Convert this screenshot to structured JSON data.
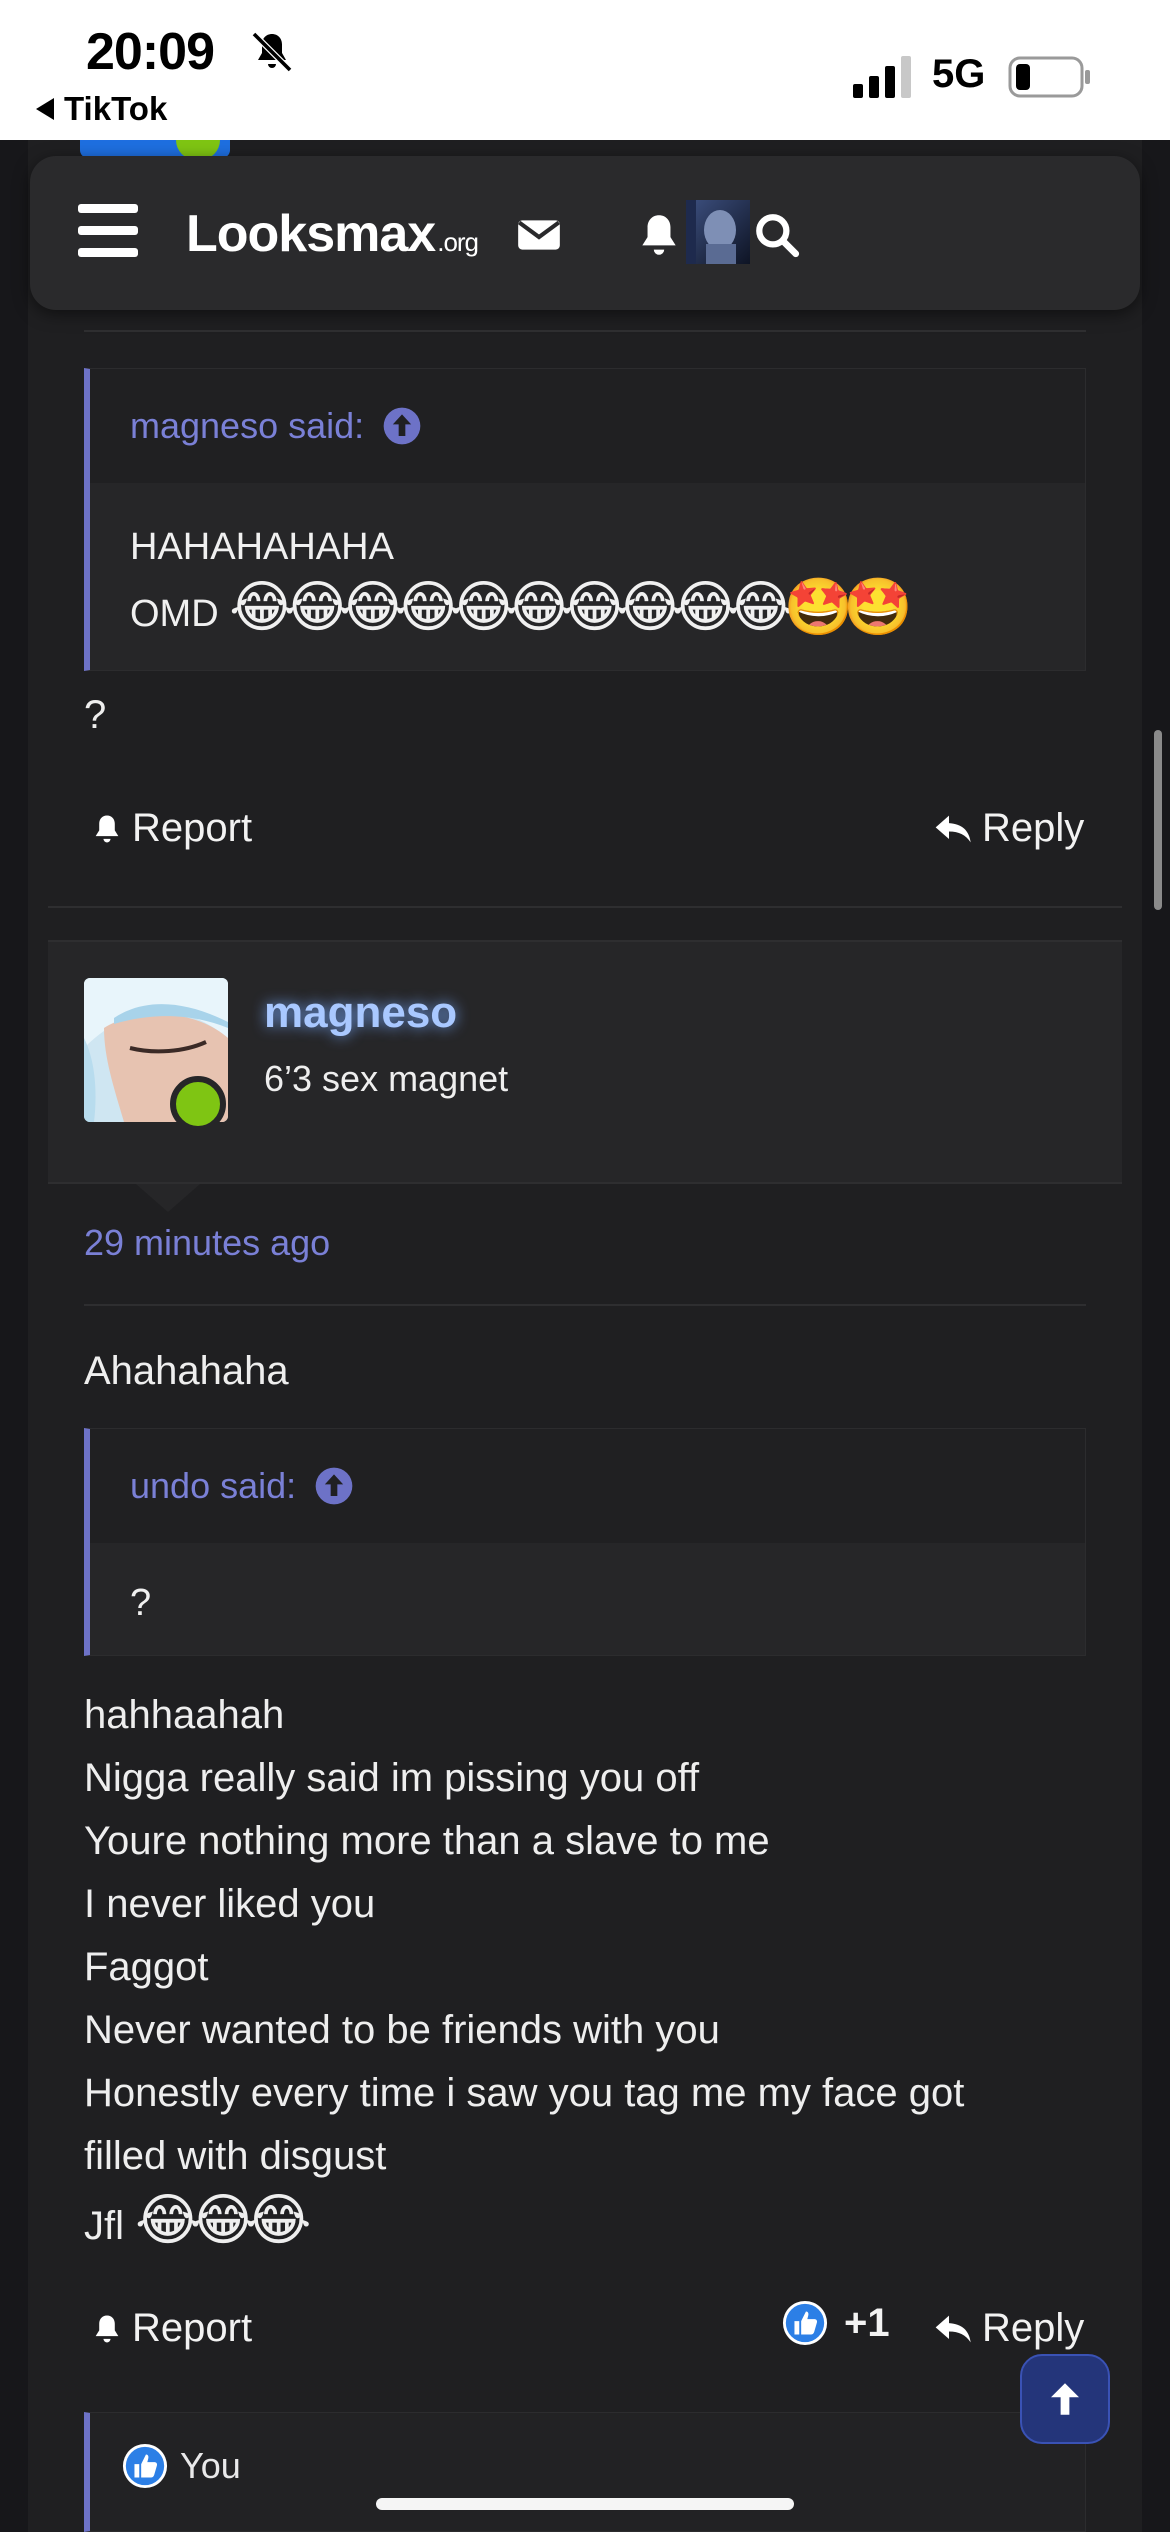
{
  "status_bar": {
    "time": "20:09",
    "back_app": "TikTok",
    "network": "5G"
  },
  "navbar": {
    "logo_main": "Looksmax",
    "logo_suffix": ".org"
  },
  "post1": {
    "quote_author": "magneso said:",
    "quote_lines": [
      "HAHAHAHAHA",
      "OMD"
    ],
    "quote_emoji": "😂😂😂😂😂😂😂😂😂😂🤩🤩",
    "body": "?",
    "report_label": "Report",
    "reply_label": "Reply"
  },
  "post2": {
    "username": "magneso",
    "user_title": "6’3 sex magnet",
    "timestamp": "29 minutes ago",
    "intro": "Ahahahaha",
    "quote_author": "undo said:",
    "quote_body": "?",
    "body_lines": [
      "hahhaahah",
      "Nigga really said im pissing you off",
      "Youre nothing more than a slave to me",
      "I never liked you",
      "Faggot",
      "Never wanted to be friends with you",
      "Honestly every time i saw you tag me my face got",
      "filled with disgust"
    ],
    "last_line": "Jfl",
    "last_emoji": "😂😂😂",
    "report_label": "Report",
    "like_count": "+1",
    "reply_label": "Reply",
    "liked_by": "You"
  }
}
